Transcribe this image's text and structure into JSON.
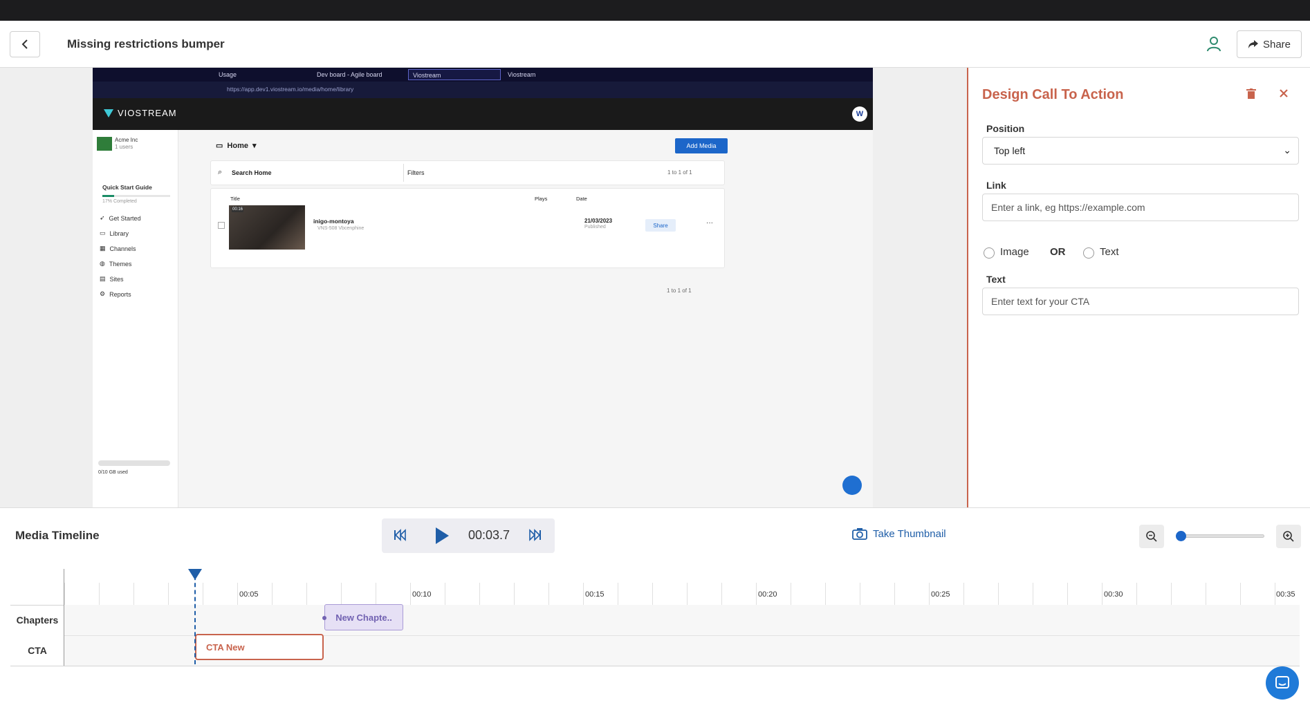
{
  "header": {
    "title": "Missing restrictions bumper",
    "share_label": "Share"
  },
  "preview": {
    "browser_tabs": [
      "Usage",
      "Dev board - Agile board",
      "Viostream",
      "Viostream"
    ],
    "url": "https://app.dev1.viostream.io/media/home/library",
    "brand": "VIOSTREAM",
    "avatar_letter": "W",
    "org_name": "Acme Inc",
    "org_users": "1 users",
    "quick_start": "Quick Start Guide",
    "quick_start_progress": "17% Completed",
    "nav_items": [
      "Get Started",
      "Library",
      "Channels",
      "Themes",
      "Sites",
      "Reports"
    ],
    "storage": "0/10 GB used",
    "folder": "Home",
    "add_media": "Add Media",
    "search_placeholder": "Search Home",
    "filters": "Filters",
    "pagination": "1 to 1 of 1",
    "col_title": "Title",
    "col_plays": "Plays",
    "col_date": "Date",
    "media_name": "inigo-montoya",
    "media_sub": "VNS-508 Vbcenphine",
    "duration": "00:16",
    "media_date": "21/03/2023",
    "media_status": "Published",
    "row_share": "Share"
  },
  "cta_panel": {
    "title": "Design Call To Action",
    "position_label": "Position",
    "position_value": "Top left",
    "link_label": "Link",
    "link_placeholder": "Enter a link, eg https://example.com",
    "image_label": "Image",
    "or_label": "OR",
    "text_option_label": "Text",
    "text_label": "Text",
    "text_placeholder": "Enter text for your CTA",
    "accent_color": "#c8634c"
  },
  "timeline": {
    "title": "Media Timeline",
    "current_time": "00:03.7",
    "take_thumbnail": "Take Thumbnail",
    "zoom_level": 0,
    "ticks": [
      "00:05",
      "00:10",
      "00:15",
      "00:20",
      "00:25",
      "00:30",
      "00:35"
    ],
    "rows": [
      "Chapters",
      "CTA"
    ],
    "chapter_label": "New Chapte..",
    "cta_label": "CTA New"
  }
}
